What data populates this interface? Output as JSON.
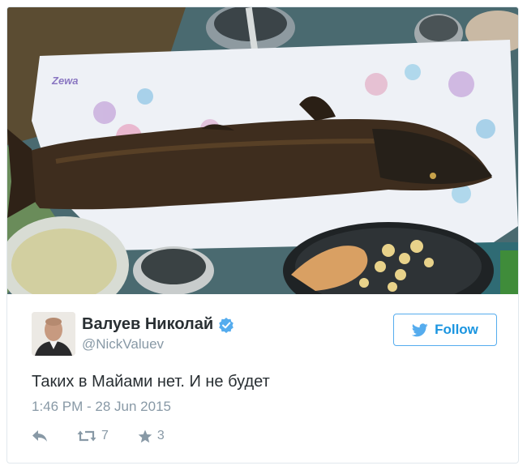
{
  "tweet": {
    "display_name": "Валуев Николай",
    "handle": "@NickValuev",
    "text": "Таких в Майами нет. И не будет",
    "timestamp": "1:46 PM - 28 Jun 2015",
    "verified": true
  },
  "follow_button": {
    "label": "Follow",
    "icon": "twitter-bird-icon"
  },
  "actions": {
    "reply": {
      "icon": "reply-icon"
    },
    "retweet": {
      "icon": "retweet-icon",
      "count": "7"
    },
    "favorite": {
      "icon": "star-icon",
      "count": "3"
    }
  },
  "photo": {
    "towel_brand": "Zewa"
  },
  "colors": {
    "twitter_blue": "#1b95e0",
    "button_border": "#55acee",
    "secondary_text": "#8899a6",
    "primary_text": "#292f33"
  }
}
